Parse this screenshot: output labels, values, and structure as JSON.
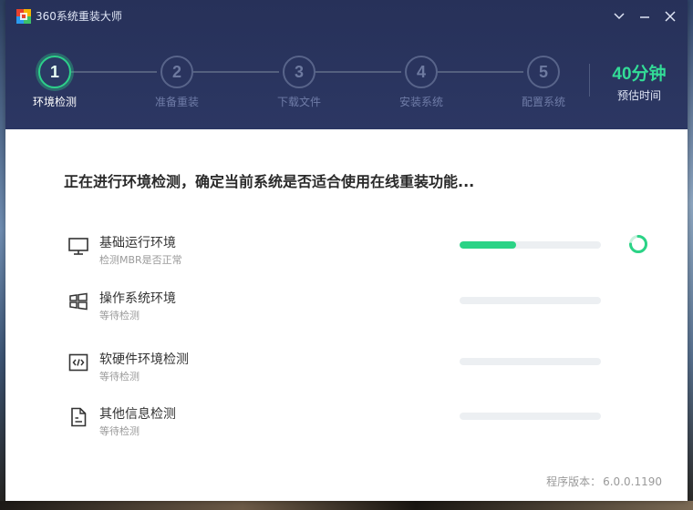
{
  "app": {
    "title": "360系统重装大师",
    "controls": [
      "chevron-down-icon",
      "minimize-icon",
      "close-icon"
    ]
  },
  "steps": [
    {
      "number": "1",
      "label": "环境检测",
      "active": true
    },
    {
      "number": "2",
      "label": "准备重装",
      "active": false
    },
    {
      "number": "3",
      "label": "下载文件",
      "active": false
    },
    {
      "number": "4",
      "label": "安装系统",
      "active": false
    },
    {
      "number": "5",
      "label": "配置系统",
      "active": false
    }
  ],
  "eta": {
    "value": "40分钟",
    "label": "预估时间"
  },
  "main": {
    "heading": "正在进行环境检测，确定当前系统是否适合使用在线重装功能...",
    "checks": [
      {
        "icon": "monitor-icon",
        "title": "基础运行环境",
        "status": "检测MBR是否正常",
        "progress": 0.4,
        "loading": true
      },
      {
        "icon": "windows-icon",
        "title": "操作系统环境",
        "status": "等待检测",
        "progress": 0,
        "loading": false
      },
      {
        "icon": "code-icon",
        "title": "软硬件环境检测",
        "status": "等待检测",
        "progress": 0,
        "loading": false
      },
      {
        "icon": "document-icon",
        "title": "其他信息检测",
        "status": "等待检测",
        "progress": 0,
        "loading": false
      }
    ]
  },
  "footer": {
    "version_label": "程序版本：",
    "version": "6.0.0.1190"
  },
  "colors": {
    "header": "#2a3560",
    "accent": "#2bd386",
    "track": "#eceff2"
  }
}
